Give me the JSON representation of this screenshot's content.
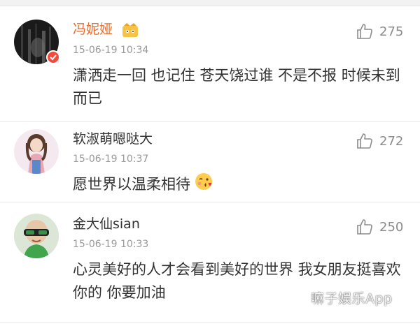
{
  "comments": [
    {
      "username": "冯妮娅",
      "timestamp": "15-06-19 10:34",
      "content": "潇洒走一回 也记住 苍天饶过谁 不是不报 时候未到而已",
      "likes": "275",
      "username_color": "#e86c2c"
    },
    {
      "username": "软淑萌嗯哒大",
      "timestamp": "15-06-19 10:37",
      "content": "愿世界以温柔相待",
      "likes": "272"
    },
    {
      "username": "金大仙sian",
      "timestamp": "15-06-19 10:33",
      "content": "心灵美好的人才会看到美好的世界  我女朋友挺喜欢你的  你要加油",
      "likes": "250"
    }
  ],
  "watermark": "嘛子娱乐App",
  "colors": {
    "badge": "#f04b3e",
    "meta": "#9a9a9a",
    "text": "#333333"
  }
}
